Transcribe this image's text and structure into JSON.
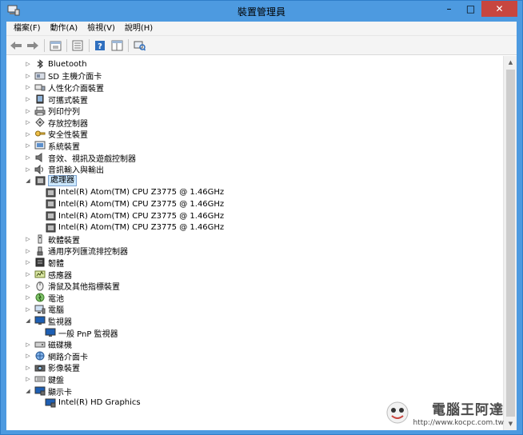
{
  "window": {
    "title": "裝置管理員"
  },
  "window_controls": {
    "minimize": "–",
    "maximize": "□",
    "close": "✕"
  },
  "menu": [
    "檔案(F)",
    "動作(A)",
    "檢視(V)",
    "說明(H)"
  ],
  "toolbar_icons": [
    "back-arrow-icon",
    "forward-arrow-icon",
    "properties-icon",
    "list-icon",
    "help-icon",
    "grid-icon",
    "scan-hardware-icon"
  ],
  "tree": [
    {
      "label": "Bluetooth",
      "depth": 1,
      "expander": "▷",
      "icon": "bluetooth-icon"
    },
    {
      "label": "SD 主機介面卡",
      "depth": 1,
      "expander": "▷",
      "icon": "sd-host-icon"
    },
    {
      "label": "人性化介面裝置",
      "depth": 1,
      "expander": "▷",
      "icon": "hid-icon"
    },
    {
      "label": "可攜式裝置",
      "depth": 1,
      "expander": "▷",
      "icon": "portable-device-icon"
    },
    {
      "label": "列印佇列",
      "depth": 1,
      "expander": "▷",
      "icon": "printer-icon"
    },
    {
      "label": "存放控制器",
      "depth": 1,
      "expander": "▷",
      "icon": "storage-controller-icon"
    },
    {
      "label": "安全性裝置",
      "depth": 1,
      "expander": "▷",
      "icon": "security-key-icon"
    },
    {
      "label": "系統裝置",
      "depth": 1,
      "expander": "▷",
      "icon": "system-device-icon"
    },
    {
      "label": "音效、視訊及遊戲控制器",
      "depth": 1,
      "expander": "▷",
      "icon": "speaker-icon"
    },
    {
      "label": "音訊輸入與輸出",
      "depth": 1,
      "expander": "▷",
      "icon": "audio-io-icon"
    },
    {
      "label": "處理器",
      "depth": 1,
      "expander": "◢",
      "icon": "processor-icon",
      "selected": true
    },
    {
      "label": "Intel(R) Atom(TM) CPU  Z3775  @ 1.46GHz",
      "depth": 2,
      "expander": "",
      "icon": "processor-icon"
    },
    {
      "label": "Intel(R) Atom(TM) CPU  Z3775  @ 1.46GHz",
      "depth": 2,
      "expander": "",
      "icon": "processor-icon"
    },
    {
      "label": "Intel(R) Atom(TM) CPU  Z3775  @ 1.46GHz",
      "depth": 2,
      "expander": "",
      "icon": "processor-icon"
    },
    {
      "label": "Intel(R) Atom(TM) CPU  Z3775  @ 1.46GHz",
      "depth": 2,
      "expander": "",
      "icon": "processor-icon"
    },
    {
      "label": "軟體裝置",
      "depth": 1,
      "expander": "▷",
      "icon": "software-device-icon"
    },
    {
      "label": "通用序列匯流排控制器",
      "depth": 1,
      "expander": "▷",
      "icon": "usb-icon"
    },
    {
      "label": "韌體",
      "depth": 1,
      "expander": "▷",
      "icon": "firmware-icon"
    },
    {
      "label": "感應器",
      "depth": 1,
      "expander": "▷",
      "icon": "sensor-icon"
    },
    {
      "label": "滑鼠及其他指標裝置",
      "depth": 1,
      "expander": "▷",
      "icon": "mouse-icon"
    },
    {
      "label": "電池",
      "depth": 1,
      "expander": "▷",
      "icon": "battery-icon"
    },
    {
      "label": "電腦",
      "depth": 1,
      "expander": "▷",
      "icon": "computer-icon"
    },
    {
      "label": "監視器",
      "depth": 1,
      "expander": "◢",
      "icon": "monitor-icon"
    },
    {
      "label": "一般 PnP 監視器",
      "depth": 2,
      "expander": "",
      "icon": "monitor-icon"
    },
    {
      "label": "磁碟機",
      "depth": 1,
      "expander": "▷",
      "icon": "disk-drive-icon"
    },
    {
      "label": "網路介面卡",
      "depth": 1,
      "expander": "▷",
      "icon": "network-adapter-icon"
    },
    {
      "label": "影像裝置",
      "depth": 1,
      "expander": "▷",
      "icon": "imaging-device-icon"
    },
    {
      "label": "鍵盤",
      "depth": 1,
      "expander": "▷",
      "icon": "keyboard-icon"
    },
    {
      "label": "顯示卡",
      "depth": 1,
      "expander": "◢",
      "icon": "display-adapter-icon"
    },
    {
      "label": "Intel(R) HD Graphics",
      "depth": 2,
      "expander": "",
      "icon": "display-adapter-icon"
    }
  ],
  "scrollbar": {
    "up": "▲",
    "down": "▼"
  },
  "watermark": {
    "title": "電腦王阿達",
    "url": "http://www.kocpc.com.tw"
  },
  "colors": {
    "titlebar": "#4d9ae0",
    "close_button": "#c7463f",
    "selection": "#cce8ff"
  }
}
